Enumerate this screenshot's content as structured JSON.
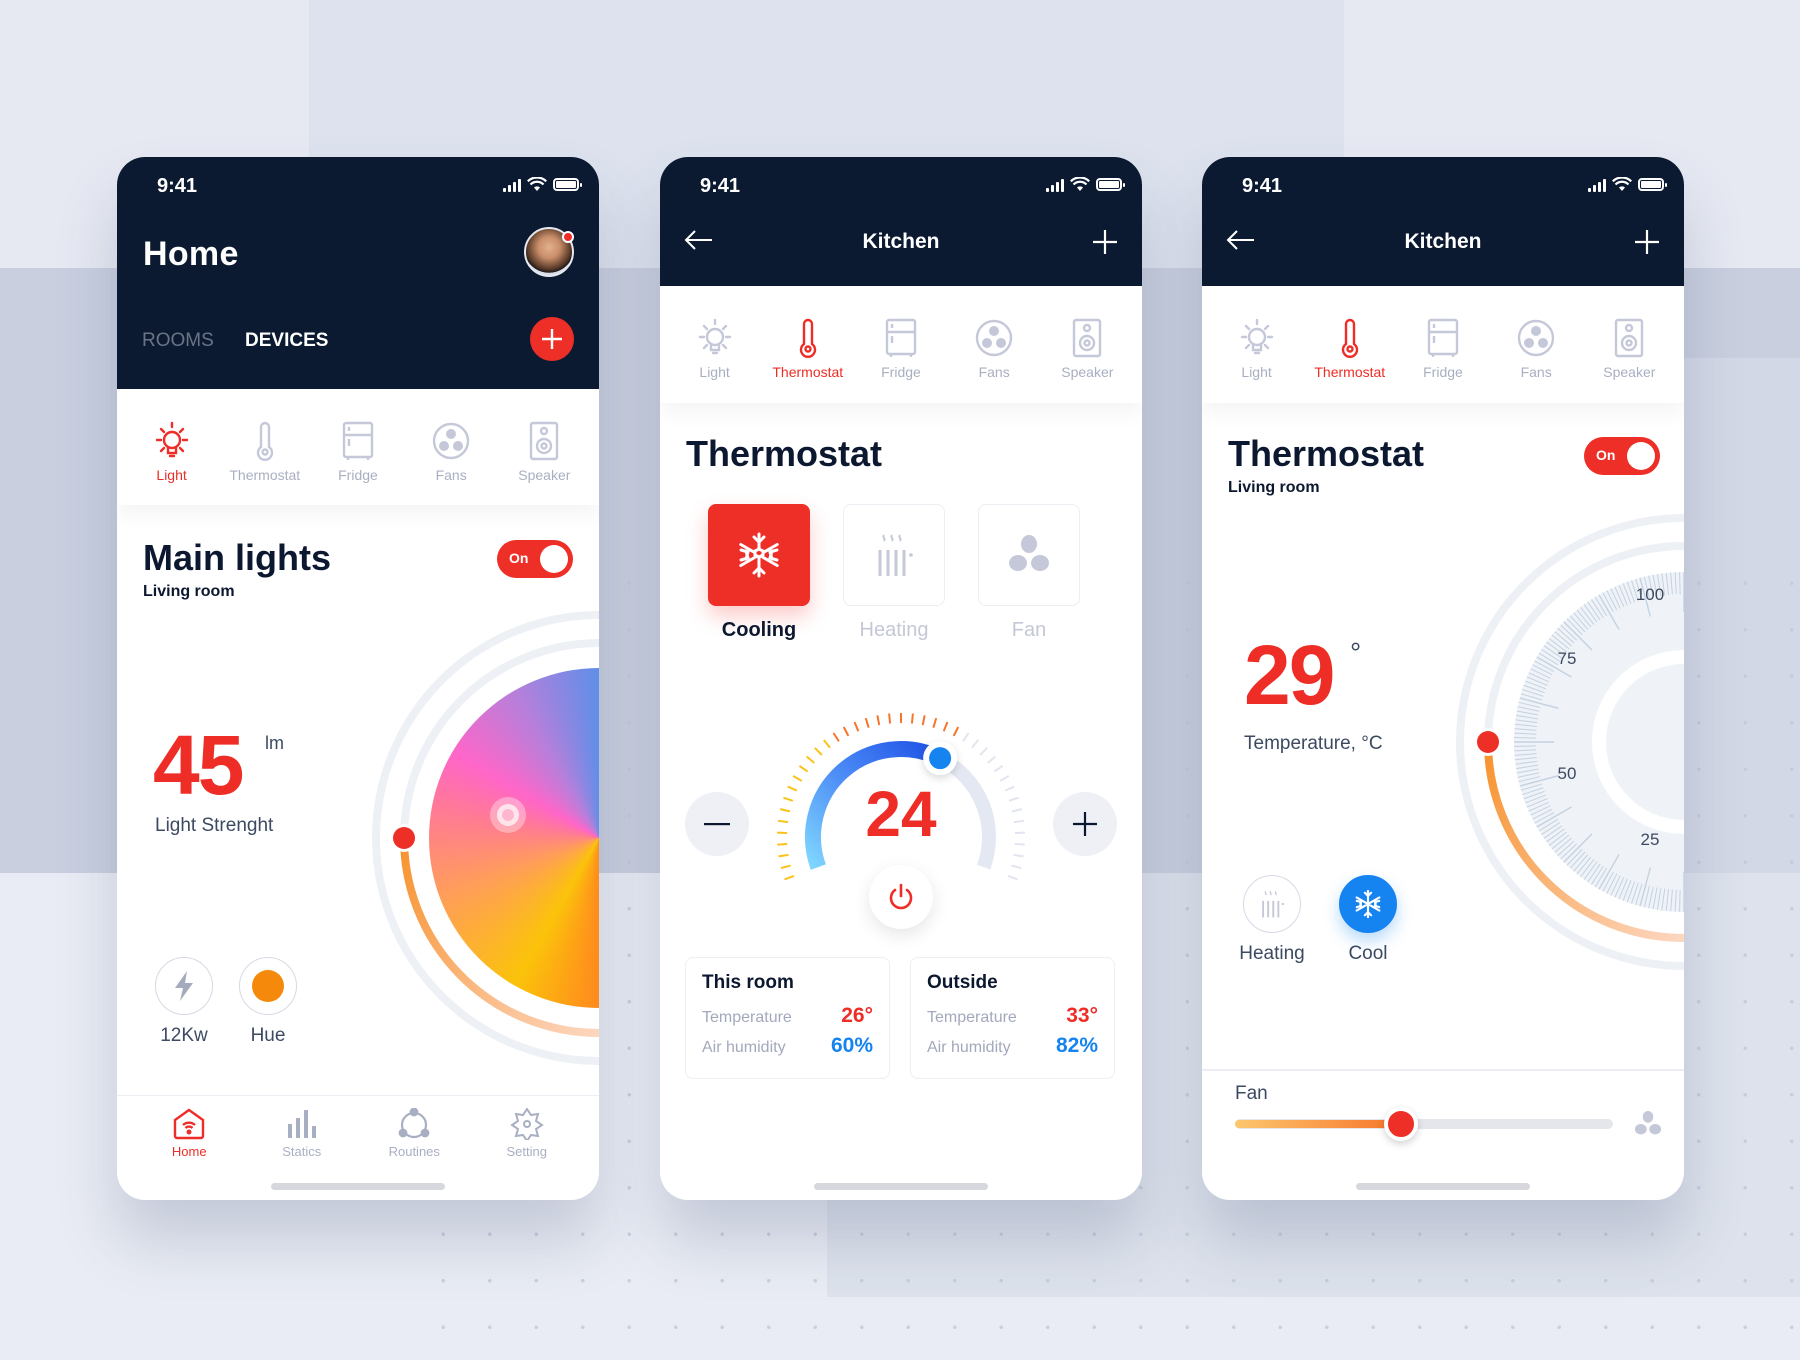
{
  "status_time": "9:41",
  "colors": {
    "accent_red": "#EE2D26",
    "navy": "#0B1A30",
    "blue": "#1583F0",
    "muted": "#A9AFC2"
  },
  "device_tabs": [
    {
      "label": "Light",
      "icon": "lightbulb-icon"
    },
    {
      "label": "Thermostat",
      "icon": "thermometer-icon"
    },
    {
      "label": "Fridge",
      "icon": "fridge-icon"
    },
    {
      "label": "Fans",
      "icon": "fan-icon"
    },
    {
      "label": "Speaker",
      "icon": "speaker-icon"
    }
  ],
  "screen_home": {
    "title": "Home",
    "segments": [
      "ROOMS",
      "DEVICES"
    ],
    "active_segment": "DEVICES",
    "active_tab": "Light",
    "device_title": "Main lights",
    "device_room": "Living room",
    "toggle_label": "On",
    "toggle_on": true,
    "light_value": "45",
    "light_unit": "lm",
    "light_caption": "Light Strenght",
    "quick_controls": [
      {
        "label": "12Kw",
        "icon": "lightning-icon"
      },
      {
        "label": "Hue",
        "icon": "hue-dot-icon",
        "color": "#F5890C"
      }
    ],
    "bottom_nav": [
      {
        "label": "Home",
        "icon": "home-icon",
        "active": true
      },
      {
        "label": "Statics",
        "icon": "bar-chart-icon",
        "active": false
      },
      {
        "label": "Routines",
        "icon": "routines-icon",
        "active": false
      },
      {
        "label": "Setting",
        "icon": "gear-icon",
        "active": false
      }
    ]
  },
  "screen_thermostat_modes": {
    "nav_title": "Kitchen",
    "active_tab": "Thermostat",
    "title": "Thermostat",
    "modes": [
      {
        "label": "Cooling",
        "icon": "snowflake-icon",
        "active": true
      },
      {
        "label": "Heating",
        "icon": "heater-icon",
        "active": false
      },
      {
        "label": "Fan",
        "icon": "fan-blades-icon",
        "active": false
      }
    ],
    "setpoint": "24",
    "setpoint_fraction": 0.62,
    "minus_label": "−",
    "plus_label": "+",
    "cards": [
      {
        "title": "This room",
        "temperature_label": "Temperature",
        "temperature": "26°",
        "humidity_label": "Air humidity",
        "humidity": "60%"
      },
      {
        "title": "Outside",
        "temperature_label": "Temperature",
        "temperature": "33°",
        "humidity_label": "Air humidity",
        "humidity": "82%"
      }
    ]
  },
  "screen_thermostat_dial": {
    "nav_title": "Kitchen",
    "active_tab": "Thermostat",
    "title": "Thermostat",
    "room": "Living room",
    "toggle_label": "On",
    "toggle_on": true,
    "temperature": "29",
    "degree_symbol": "°",
    "temperature_caption": "Temperature, °C",
    "dial_labels": [
      "100",
      "75",
      "50",
      "25"
    ],
    "modes": [
      {
        "label": "Heating",
        "icon": "heater-icon",
        "active": false
      },
      {
        "label": "Cool",
        "icon": "snowflake-icon",
        "active": true
      }
    ],
    "fan_label": "Fan",
    "fan_level": 0.44
  }
}
